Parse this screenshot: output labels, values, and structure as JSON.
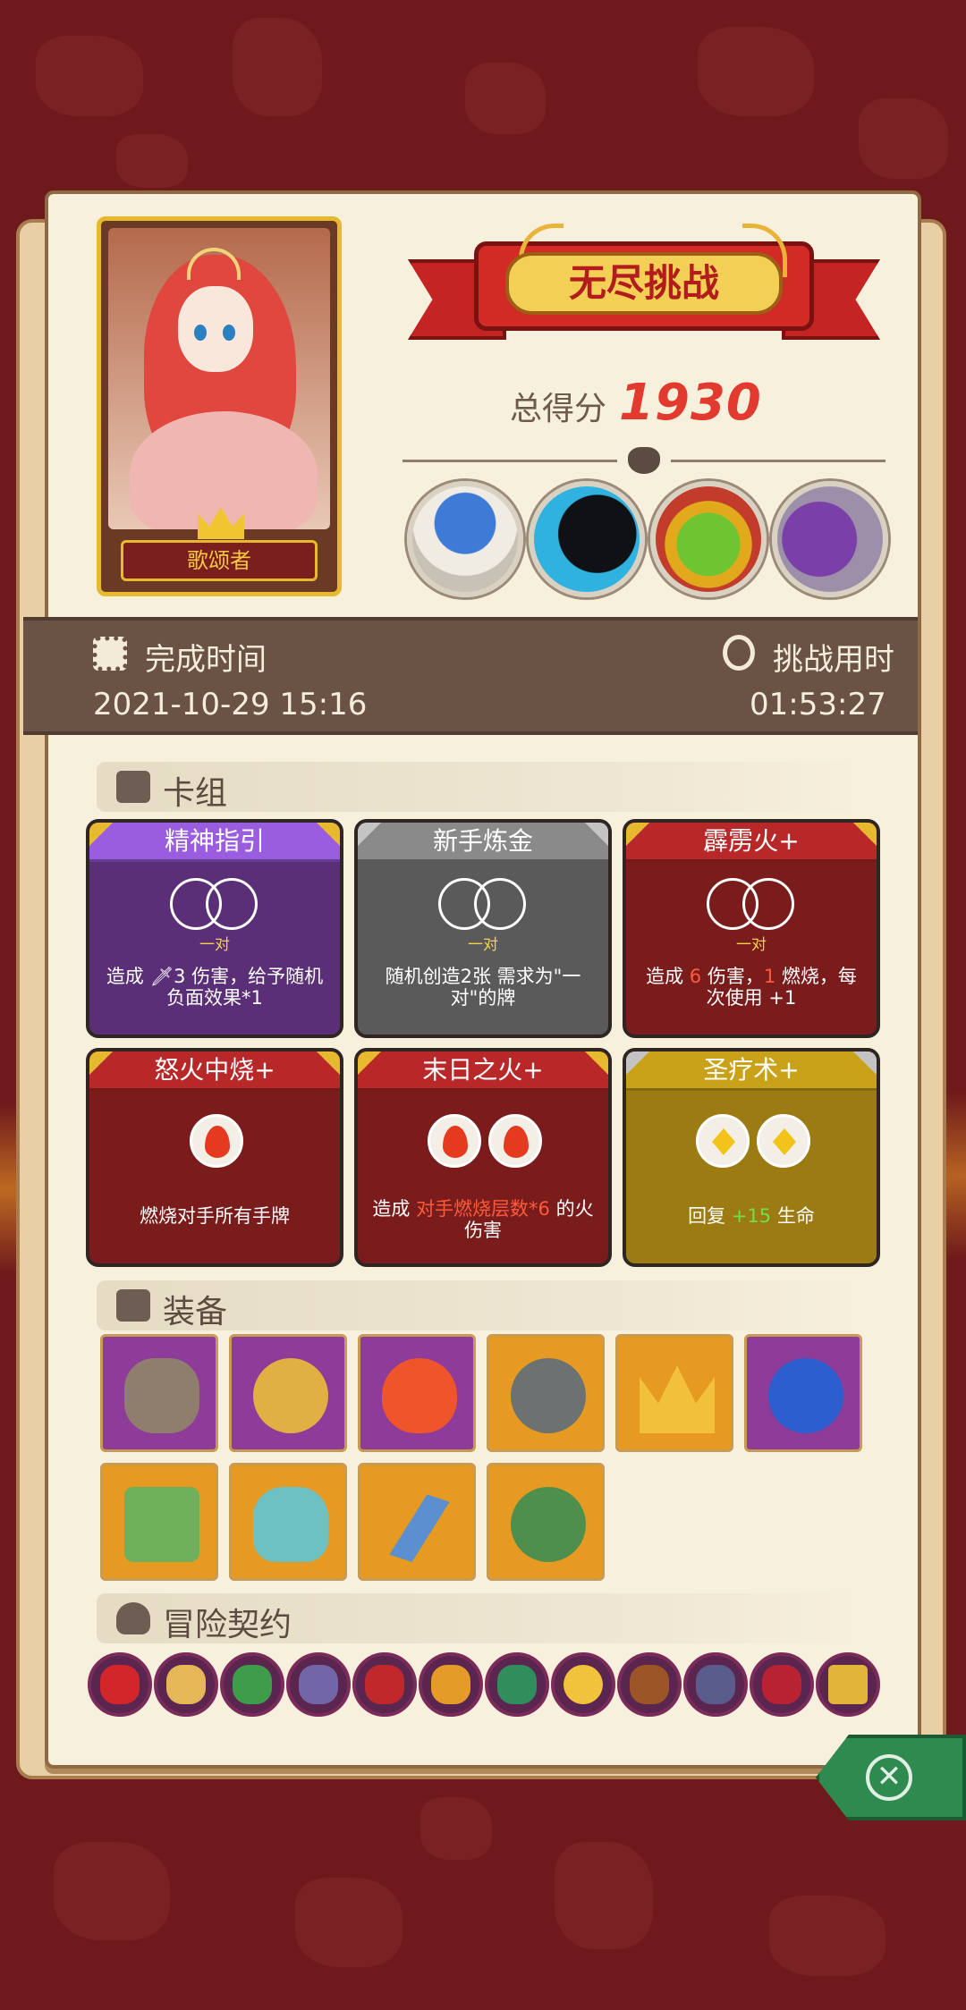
{
  "hero": {
    "name": "歌颂者"
  },
  "banner": {
    "title": "无尽挑战"
  },
  "score": {
    "label": "总得分",
    "value": "1930"
  },
  "bosses": [
    {
      "name": "mushroom-sage-boss"
    },
    {
      "name": "shadow-beast-boss"
    },
    {
      "name": "goblin-king-boss"
    },
    {
      "name": "purple-dragon-boss"
    }
  ],
  "time": {
    "finish_label": "完成时间",
    "finish_value": "2021-10-29 15:16",
    "duration_label": "挑战用时",
    "duration_value": "01:53:27"
  },
  "deck": {
    "title": "卡组",
    "cards": [
      {
        "name": "精神指引",
        "color": "#5a2f77",
        "head": "#9a5de0",
        "req": "一对",
        "desc": "造成 🗡3 伤害，给予随机负面效果*1"
      },
      {
        "name": "新手炼金",
        "color": "#5a5a5a",
        "head": "#8a8a8a",
        "req": "一对",
        "desc": "随机创造2张 需求为\"一对\"的牌"
      },
      {
        "name": "霹雳火+",
        "color": "#7a1c1c",
        "head": "#b82828",
        "req": "一对",
        "desc_pre": "造成 ",
        "desc_red1": "6",
        "desc_mid": " 伤害，",
        "desc_red2": "1",
        "desc_post": " 燃烧，每次使用 ",
        "desc_end": "+1"
      },
      {
        "name": "怒火中烧+",
        "color": "#7a1c1c",
        "head": "#b82828",
        "desc": "燃烧对手所有手牌"
      },
      {
        "name": "末日之火+",
        "color": "#7a1c1c",
        "head": "#b82828",
        "desc_pre": "造成 ",
        "desc_red": "对手燃烧层数*6",
        "desc_post": " 的火伤害"
      },
      {
        "name": "圣疗术+",
        "color": "#9b7b12",
        "head": "#c9a219",
        "desc_pre": "回复 ",
        "desc_green": "+15",
        "desc_post": " 生命"
      }
    ]
  },
  "equipment": {
    "title": "装备",
    "items": [
      {
        "name": "fire-stone-icon",
        "rarity": "purple"
      },
      {
        "name": "blood-ring-icon",
        "rarity": "purple"
      },
      {
        "name": "fire-essence-icon",
        "rarity": "purple"
      },
      {
        "name": "spiked-shield-icon",
        "rarity": "orange"
      },
      {
        "name": "golden-crown-icon",
        "rarity": "orange"
      },
      {
        "name": "blue-spirit-icon",
        "rarity": "purple"
      },
      {
        "name": "slime-tome-icon",
        "rarity": "orange"
      },
      {
        "name": "cyan-vase-icon",
        "rarity": "orange"
      },
      {
        "name": "broken-bottle-icon",
        "rarity": "orange"
      },
      {
        "name": "turtle-shell-icon",
        "rarity": "orange"
      }
    ]
  },
  "contracts": {
    "title": "冒险契约",
    "items": [
      "demon-mask-icon",
      "horn-icon",
      "green-star-icon",
      "fist-badge-icon",
      "heart-lock-icon",
      "torch-icon",
      "green-bandage-icon",
      "gold-coin-icon",
      "pipe-icon",
      "claw-icon",
      "monster-mouth-icon",
      "mystery-box-icon"
    ]
  },
  "close": {
    "label": "✕"
  }
}
